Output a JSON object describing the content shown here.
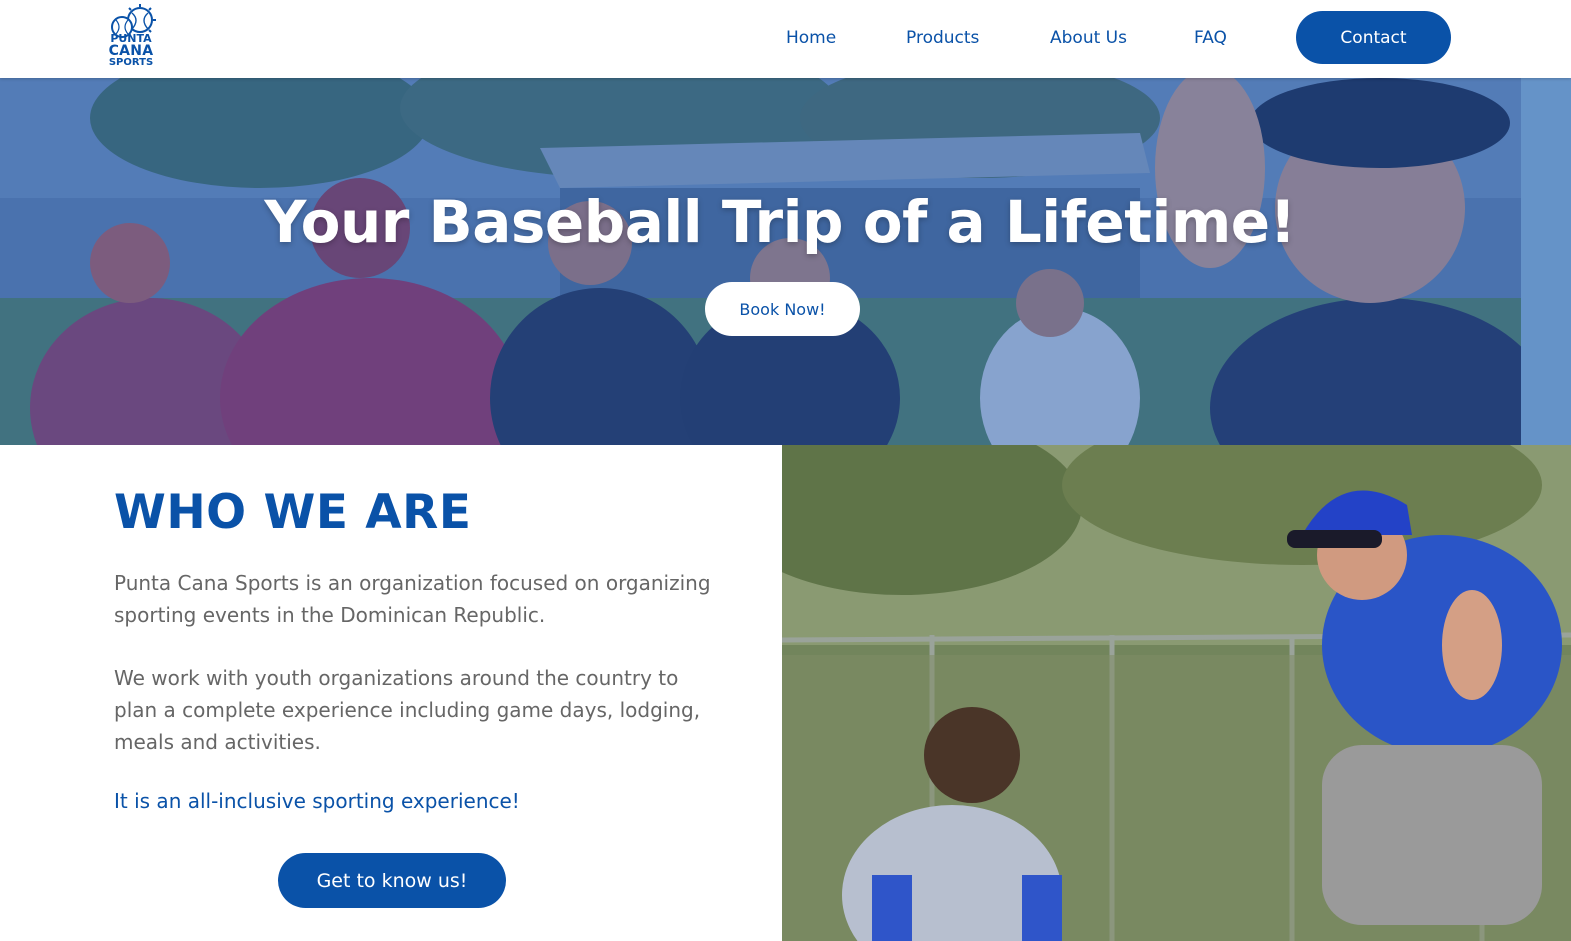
{
  "brand": {
    "logo_line1": "PUNTA",
    "logo_line2": "CANA",
    "logo_line3": "SPORTS",
    "primary_color": "#0a52a8"
  },
  "nav": {
    "items": [
      {
        "label": "Home"
      },
      {
        "label": "Products"
      },
      {
        "label": "About Us"
      },
      {
        "label": "FAQ"
      }
    ],
    "contact_label": "Contact"
  },
  "hero": {
    "title": "Your Baseball Trip of a Lifetime!",
    "cta_label": "Book Now!"
  },
  "who": {
    "title": "WHO WE ARE",
    "paragraph1": "Punta Cana Sports is an organization focused on organizing sporting events in the Dominican Republic.",
    "paragraph2": "We work with youth organizations around the country to plan a complete experience including game days, lodging, meals and activities.",
    "highlight": "It is an all-inclusive sporting experience!",
    "cta_label": "Get to know us!"
  }
}
